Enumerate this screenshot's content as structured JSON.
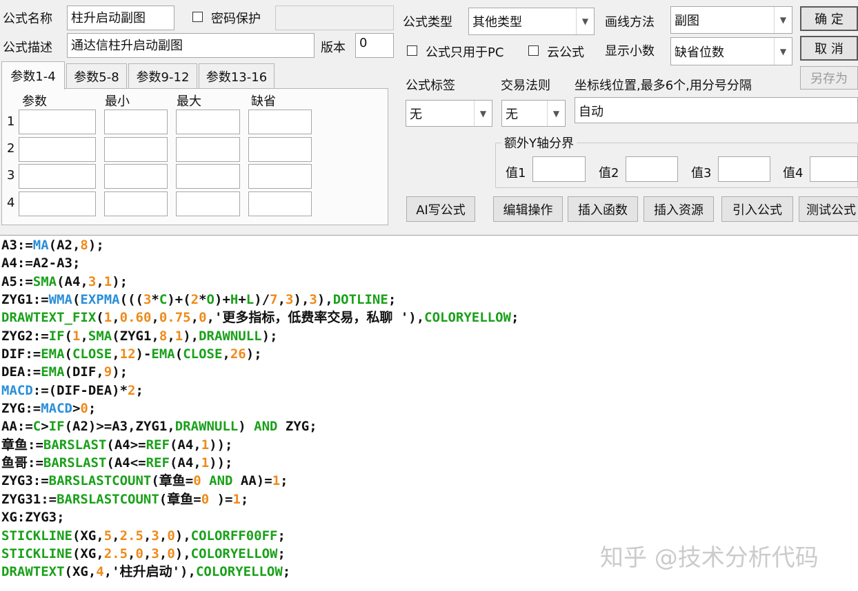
{
  "form": {
    "name_label": "公式名称",
    "name_value": "柱升启动副图",
    "password_label": "密码保护",
    "password_checked": false,
    "desc_label": "公式描述",
    "desc_value": "通达信柱升启动副图",
    "version_label": "版本",
    "version_value": "0",
    "type_label": "公式类型",
    "type_value": "其他类型",
    "draw_label": "画线方法",
    "draw_value": "副图",
    "pc_only_label": "公式只用于PC",
    "pc_only_checked": false,
    "cloud_label": "云公式",
    "cloud_checked": false,
    "decimals_label": "显示小数",
    "decimals_value": "缺省位数",
    "ok_button": "确 定",
    "cancel_button": "取 消",
    "saveas_button": "另存为",
    "tag_label": "公式标签",
    "tag_value": "无",
    "trade_label": "交易法则",
    "trade_value": "无",
    "coord_label": "坐标线位置,最多6个,用分号分隔",
    "coord_value": "自动",
    "yaxis_group_label": "额外Y轴分界",
    "y_labels": [
      "值1",
      "值2",
      "值3",
      "值4"
    ]
  },
  "params": {
    "tabs": [
      "参数1-4",
      "参数5-8",
      "参数9-12",
      "参数13-16"
    ],
    "active_tab": 0,
    "headers": [
      "参数",
      "最小",
      "最大",
      "缺省"
    ],
    "rows": [
      "1",
      "2",
      "3",
      "4"
    ]
  },
  "toolbar": [
    "AI写公式",
    "编辑操作",
    "插入函数",
    "插入资源",
    "引入公式",
    "测试公式"
  ],
  "colors": {
    "func": "#1aa11a",
    "builtin": "#2a8fd8",
    "number": "#ee8a1a",
    "text": "#111111"
  },
  "code_lines": [
    [
      [
        "A3:=",
        "t"
      ],
      [
        "MA",
        "b"
      ],
      [
        "(A2,",
        "t"
      ],
      [
        "8",
        "n"
      ],
      [
        ");",
        "t"
      ]
    ],
    [
      [
        "A4:=A2-A3;",
        "t"
      ]
    ],
    [
      [
        "A5:=",
        "t"
      ],
      [
        "SMA",
        "f"
      ],
      [
        "(A4,",
        "t"
      ],
      [
        "3",
        "n"
      ],
      [
        ",",
        "t"
      ],
      [
        "1",
        "n"
      ],
      [
        ");",
        "t"
      ]
    ],
    [
      [
        "ZYG1:=",
        "t"
      ],
      [
        "WMA",
        "b"
      ],
      [
        "(",
        "t"
      ],
      [
        "EXPMA",
        "b"
      ],
      [
        "(((",
        "t"
      ],
      [
        "3",
        "n"
      ],
      [
        "*",
        "t"
      ],
      [
        "C",
        "f"
      ],
      [
        ")+(",
        "t"
      ],
      [
        "2",
        "n"
      ],
      [
        "*",
        "t"
      ],
      [
        "O",
        "f"
      ],
      [
        ")+",
        "t"
      ],
      [
        "H",
        "f"
      ],
      [
        "+",
        "t"
      ],
      [
        "L",
        "f"
      ],
      [
        ")/",
        "t"
      ],
      [
        "7",
        "n"
      ],
      [
        ",",
        "t"
      ],
      [
        "3",
        "n"
      ],
      [
        "),",
        "t"
      ],
      [
        "3",
        "n"
      ],
      [
        "),",
        "t"
      ],
      [
        "DOTLINE",
        "f"
      ],
      [
        ";",
        "t"
      ]
    ],
    [
      [
        "DRAWTEXT_FIX",
        "f"
      ],
      [
        "(",
        "t"
      ],
      [
        "1",
        "n"
      ],
      [
        ",",
        "t"
      ],
      [
        "0.60",
        "n"
      ],
      [
        ",",
        "t"
      ],
      [
        "0.75",
        "n"
      ],
      [
        ",",
        "t"
      ],
      [
        "0",
        "n"
      ],
      [
        ",'更多指标，低费率交易，私聊 '),",
        "t"
      ],
      [
        "COLORYELLOW",
        "f"
      ],
      [
        ";",
        "t"
      ]
    ],
    [
      [
        "ZYG2:=",
        "t"
      ],
      [
        "IF",
        "f"
      ],
      [
        "(",
        "t"
      ],
      [
        "1",
        "n"
      ],
      [
        ",",
        "t"
      ],
      [
        "SMA",
        "f"
      ],
      [
        "(ZYG1,",
        "t"
      ],
      [
        "8",
        "n"
      ],
      [
        ",",
        "t"
      ],
      [
        "1",
        "n"
      ],
      [
        "),",
        "t"
      ],
      [
        "DRAWNULL",
        "f"
      ],
      [
        ");",
        "t"
      ]
    ],
    [
      [
        "DIF:=",
        "t"
      ],
      [
        "EMA",
        "f"
      ],
      [
        "(",
        "t"
      ],
      [
        "CLOSE",
        "f"
      ],
      [
        ",",
        "t"
      ],
      [
        "12",
        "n"
      ],
      [
        ")-",
        "t"
      ],
      [
        "EMA",
        "f"
      ],
      [
        "(",
        "t"
      ],
      [
        "CLOSE",
        "f"
      ],
      [
        ",",
        "t"
      ],
      [
        "26",
        "n"
      ],
      [
        ");",
        "t"
      ]
    ],
    [
      [
        "DEA:=",
        "t"
      ],
      [
        "EMA",
        "f"
      ],
      [
        "(DIF,",
        "t"
      ],
      [
        "9",
        "n"
      ],
      [
        ");",
        "t"
      ]
    ],
    [
      [
        "MACD",
        "b"
      ],
      [
        ":=(DIF-DEA)*",
        "t"
      ],
      [
        "2",
        "n"
      ],
      [
        ";",
        "t"
      ]
    ],
    [
      [
        "ZYG:=",
        "t"
      ],
      [
        "MACD",
        "b"
      ],
      [
        ">",
        "t"
      ],
      [
        "0",
        "n"
      ],
      [
        ";",
        "t"
      ]
    ],
    [
      [
        "AA:=",
        "t"
      ],
      [
        "C",
        "f"
      ],
      [
        ">",
        "t"
      ],
      [
        "IF",
        "f"
      ],
      [
        "(A2)>=A3,ZYG1,",
        "t"
      ],
      [
        "DRAWNULL",
        "f"
      ],
      [
        ") ",
        "t"
      ],
      [
        "AND",
        "f"
      ],
      [
        " ZYG;",
        "t"
      ]
    ],
    [
      [
        "章鱼:=",
        "t"
      ],
      [
        "BARSLAST",
        "f"
      ],
      [
        "(A4>=",
        "t"
      ],
      [
        "REF",
        "f"
      ],
      [
        "(A4,",
        "t"
      ],
      [
        "1",
        "n"
      ],
      [
        "));",
        "t"
      ]
    ],
    [
      [
        "鱼哥:=",
        "t"
      ],
      [
        "BARSLAST",
        "f"
      ],
      [
        "(A4<=",
        "t"
      ],
      [
        "REF",
        "f"
      ],
      [
        "(A4,",
        "t"
      ],
      [
        "1",
        "n"
      ],
      [
        "));",
        "t"
      ]
    ],
    [
      [
        "ZYG3:=",
        "t"
      ],
      [
        "BARSLASTCOUNT",
        "f"
      ],
      [
        "(章鱼=",
        "t"
      ],
      [
        "0",
        "n"
      ],
      [
        " ",
        "t"
      ],
      [
        "AND",
        "f"
      ],
      [
        " AA)=",
        "t"
      ],
      [
        "1",
        "n"
      ],
      [
        ";",
        "t"
      ]
    ],
    [
      [
        "ZYG31:=",
        "t"
      ],
      [
        "BARSLASTCOUNT",
        "f"
      ],
      [
        "(章鱼=",
        "t"
      ],
      [
        "0",
        "n"
      ],
      [
        " )=",
        "t"
      ],
      [
        "1",
        "n"
      ],
      [
        ";",
        "t"
      ]
    ],
    [
      [
        "XG:ZYG3;",
        "t"
      ]
    ],
    [
      [
        "STICKLINE",
        "f"
      ],
      [
        "(XG,",
        "t"
      ],
      [
        "5",
        "n"
      ],
      [
        ",",
        "t"
      ],
      [
        "2.5",
        "n"
      ],
      [
        ",",
        "t"
      ],
      [
        "3",
        "n"
      ],
      [
        ",",
        "t"
      ],
      [
        "0",
        "n"
      ],
      [
        "),",
        "t"
      ],
      [
        "COLORFF00FF",
        "f"
      ],
      [
        ";",
        "t"
      ]
    ],
    [
      [
        "STICKLINE",
        "f"
      ],
      [
        "(XG,",
        "t"
      ],
      [
        "2.5",
        "n"
      ],
      [
        ",",
        "t"
      ],
      [
        "0",
        "n"
      ],
      [
        ",",
        "t"
      ],
      [
        "3",
        "n"
      ],
      [
        ",",
        "t"
      ],
      [
        "0",
        "n"
      ],
      [
        "),",
        "t"
      ],
      [
        "COLORYELLOW",
        "f"
      ],
      [
        ";",
        "t"
      ]
    ],
    [
      [
        "DRAWTEXT",
        "f"
      ],
      [
        "(XG,",
        "t"
      ],
      [
        "4",
        "n"
      ],
      [
        ",'柱升启动'),",
        "t"
      ],
      [
        "COLORYELLOW",
        "f"
      ],
      [
        ";",
        "t"
      ]
    ]
  ],
  "watermark": "知乎 @技术分析代码"
}
